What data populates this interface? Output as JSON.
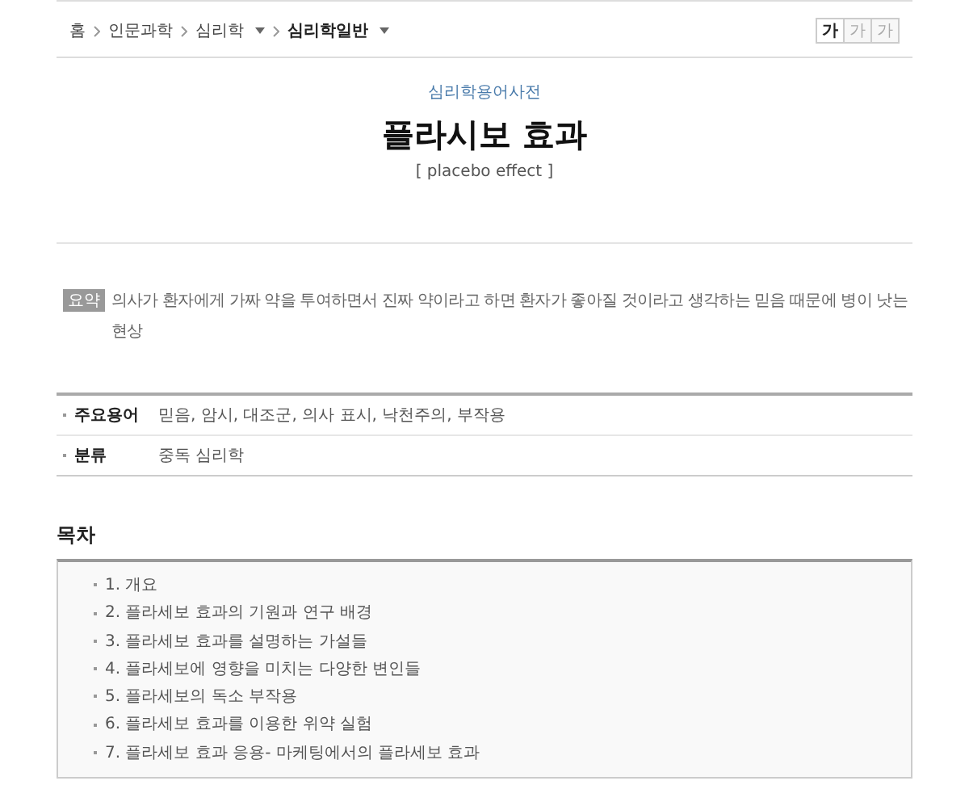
{
  "breadcrumb": [
    {
      "label": "홈",
      "caret": false,
      "current": false
    },
    {
      "label": "인문과학",
      "caret": false,
      "current": false
    },
    {
      "label": "심리학",
      "caret": true,
      "current": false
    },
    {
      "label": "심리학일반",
      "caret": true,
      "current": true
    }
  ],
  "font_sizes": [
    {
      "label": "가",
      "selected": true
    },
    {
      "label": "가",
      "selected": false
    },
    {
      "label": "가",
      "selected": false
    }
  ],
  "source": "심리학용어사전",
  "title": "플라시보 효과",
  "subtitle": "[ placebo effect ]",
  "summary": {
    "badge": "요약",
    "text": "의사가 환자에게 가짜 약을 투여하면서 진짜 약이라고 하면 환자가 좋아질 것이라고 생각하는 믿음 때문에 병이 낫는 현상"
  },
  "info": [
    {
      "label": "주요용어",
      "value": "믿음, 암시, 대조군, 의사 표시, 낙천주의, 부작용"
    },
    {
      "label": "분류",
      "value": "중독 심리학"
    }
  ],
  "toc": {
    "heading": "목차",
    "items": [
      "1. 개요",
      "2. 플라세보 효과의 기원과 연구 배경",
      "3. 플라세보 효과를 설명하는 가설들",
      "4. 플라세보에 영향을 미치는 다양한 변인들",
      "5. 플라세보의 독소 부작용",
      "6. 플라세보 효과를 이용한 위약 실험",
      "7. 플라세보 효과 응용- 마케팅에서의 플라세보 효과"
    ]
  }
}
